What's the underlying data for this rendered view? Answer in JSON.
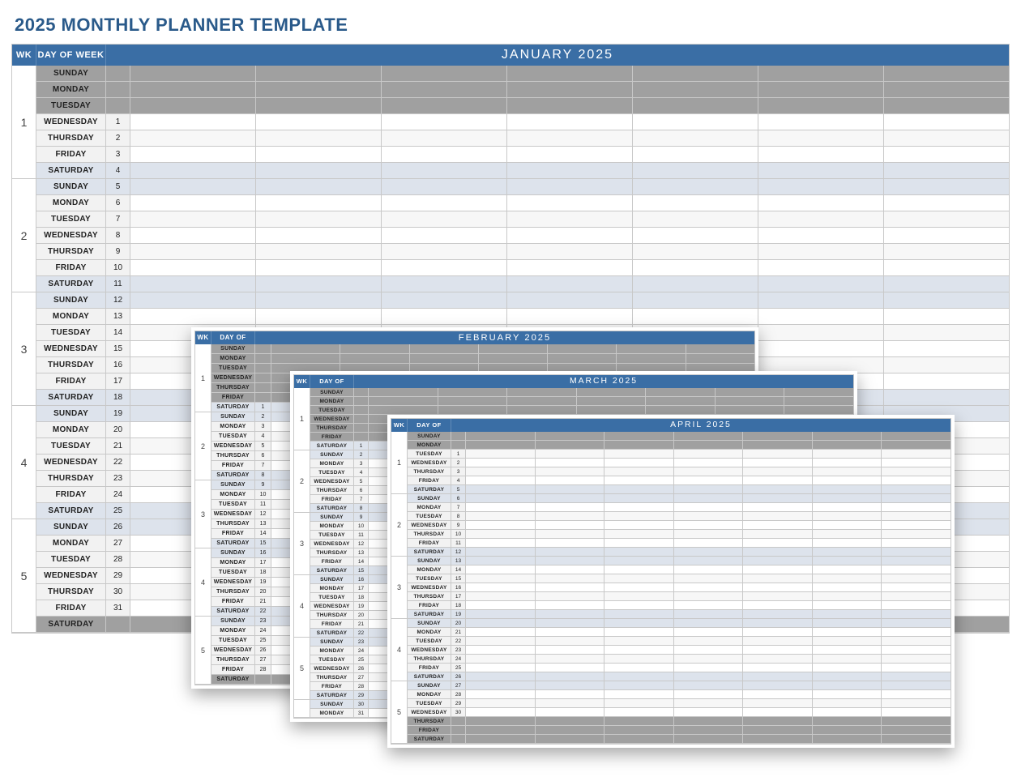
{
  "page_title": "2025 MONTHLY PLANNER TEMPLATE",
  "headers": {
    "wk": "WK",
    "dow": "DAY OF WEEK"
  },
  "day_names": [
    "SUNDAY",
    "MONDAY",
    "TUESDAY",
    "WEDNESDAY",
    "THURSDAY",
    "FRIDAY",
    "SATURDAY"
  ],
  "columns": 7,
  "planners": [
    {
      "id": "january",
      "size": "main",
      "month_label": "JANUARY 2025",
      "weeks": [
        {
          "num": 1,
          "days": [
            {
              "dow": "SUNDAY",
              "n": "",
              "type": "inactive"
            },
            {
              "dow": "MONDAY",
              "n": "",
              "type": "inactive"
            },
            {
              "dow": "TUESDAY",
              "n": "",
              "type": "inactive"
            },
            {
              "dow": "WEDNESDAY",
              "n": 1,
              "type": "normal"
            },
            {
              "dow": "THURSDAY",
              "n": 2,
              "type": "alt"
            },
            {
              "dow": "FRIDAY",
              "n": 3,
              "type": "normal"
            },
            {
              "dow": "SATURDAY",
              "n": 4,
              "type": "weekend"
            }
          ]
        },
        {
          "num": 2,
          "days": [
            {
              "dow": "SUNDAY",
              "n": 5,
              "type": "weekend"
            },
            {
              "dow": "MONDAY",
              "n": 6,
              "type": "normal"
            },
            {
              "dow": "TUESDAY",
              "n": 7,
              "type": "alt"
            },
            {
              "dow": "WEDNESDAY",
              "n": 8,
              "type": "normal"
            },
            {
              "dow": "THURSDAY",
              "n": 9,
              "type": "alt"
            },
            {
              "dow": "FRIDAY",
              "n": 10,
              "type": "normal"
            },
            {
              "dow": "SATURDAY",
              "n": 11,
              "type": "weekend"
            }
          ]
        },
        {
          "num": 3,
          "days": [
            {
              "dow": "SUNDAY",
              "n": 12,
              "type": "weekend"
            },
            {
              "dow": "MONDAY",
              "n": 13,
              "type": "normal"
            },
            {
              "dow": "TUESDAY",
              "n": 14,
              "type": "alt"
            },
            {
              "dow": "WEDNESDAY",
              "n": 15,
              "type": "normal"
            },
            {
              "dow": "THURSDAY",
              "n": 16,
              "type": "alt"
            },
            {
              "dow": "FRIDAY",
              "n": 17,
              "type": "normal"
            },
            {
              "dow": "SATURDAY",
              "n": 18,
              "type": "weekend"
            }
          ]
        },
        {
          "num": 4,
          "days": [
            {
              "dow": "SUNDAY",
              "n": 19,
              "type": "weekend"
            },
            {
              "dow": "MONDAY",
              "n": 20,
              "type": "normal"
            },
            {
              "dow": "TUESDAY",
              "n": 21,
              "type": "alt"
            },
            {
              "dow": "WEDNESDAY",
              "n": 22,
              "type": "normal"
            },
            {
              "dow": "THURSDAY",
              "n": 23,
              "type": "alt"
            },
            {
              "dow": "FRIDAY",
              "n": 24,
              "type": "normal"
            },
            {
              "dow": "SATURDAY",
              "n": 25,
              "type": "weekend"
            }
          ]
        },
        {
          "num": 5,
          "days": [
            {
              "dow": "SUNDAY",
              "n": 26,
              "type": "weekend"
            },
            {
              "dow": "MONDAY",
              "n": 27,
              "type": "normal"
            },
            {
              "dow": "TUESDAY",
              "n": 28,
              "type": "alt"
            },
            {
              "dow": "WEDNESDAY",
              "n": 29,
              "type": "normal"
            },
            {
              "dow": "THURSDAY",
              "n": 30,
              "type": "alt"
            },
            {
              "dow": "FRIDAY",
              "n": 31,
              "type": "normal"
            },
            {
              "dow": "SATURDAY",
              "n": "",
              "type": "inactive"
            }
          ]
        }
      ]
    },
    {
      "id": "february",
      "size": "small1",
      "month_label": "FEBRUARY 2025",
      "weeks": [
        {
          "num": 1,
          "days": [
            {
              "dow": "SUNDAY",
              "n": "",
              "type": "inactive"
            },
            {
              "dow": "MONDAY",
              "n": "",
              "type": "inactive"
            },
            {
              "dow": "TUESDAY",
              "n": "",
              "type": "inactive"
            },
            {
              "dow": "WEDNESDAY",
              "n": "",
              "type": "inactive"
            },
            {
              "dow": "THURSDAY",
              "n": "",
              "type": "inactive"
            },
            {
              "dow": "FRIDAY",
              "n": "",
              "type": "inactive"
            },
            {
              "dow": "SATURDAY",
              "n": 1,
              "type": "weekend"
            }
          ]
        },
        {
          "num": 2,
          "days": [
            {
              "dow": "SUNDAY",
              "n": 2,
              "type": "weekend"
            },
            {
              "dow": "MONDAY",
              "n": 3,
              "type": "normal"
            },
            {
              "dow": "TUESDAY",
              "n": 4,
              "type": "alt"
            },
            {
              "dow": "WEDNESDAY",
              "n": 5,
              "type": "normal"
            },
            {
              "dow": "THURSDAY",
              "n": 6,
              "type": "alt"
            },
            {
              "dow": "FRIDAY",
              "n": 7,
              "type": "normal"
            },
            {
              "dow": "SATURDAY",
              "n": 8,
              "type": "weekend"
            }
          ]
        },
        {
          "num": 3,
          "days": [
            {
              "dow": "SUNDAY",
              "n": 9,
              "type": "weekend"
            },
            {
              "dow": "MONDAY",
              "n": 10,
              "type": "normal"
            },
            {
              "dow": "TUESDAY",
              "n": 11,
              "type": "alt"
            },
            {
              "dow": "WEDNESDAY",
              "n": 12,
              "type": "normal"
            },
            {
              "dow": "THURSDAY",
              "n": 13,
              "type": "alt"
            },
            {
              "dow": "FRIDAY",
              "n": 14,
              "type": "normal"
            },
            {
              "dow": "SATURDAY",
              "n": 15,
              "type": "weekend"
            }
          ]
        },
        {
          "num": 4,
          "days": [
            {
              "dow": "SUNDAY",
              "n": 16,
              "type": "weekend"
            },
            {
              "dow": "MONDAY",
              "n": 17,
              "type": "normal"
            },
            {
              "dow": "TUESDAY",
              "n": 18,
              "type": "alt"
            },
            {
              "dow": "WEDNESDAY",
              "n": 19,
              "type": "normal"
            },
            {
              "dow": "THURSDAY",
              "n": 20,
              "type": "alt"
            },
            {
              "dow": "FRIDAY",
              "n": 21,
              "type": "normal"
            },
            {
              "dow": "SATURDAY",
              "n": 22,
              "type": "weekend"
            }
          ]
        },
        {
          "num": 5,
          "days": [
            {
              "dow": "SUNDAY",
              "n": 23,
              "type": "weekend"
            },
            {
              "dow": "MONDAY",
              "n": 24,
              "type": "normal"
            },
            {
              "dow": "TUESDAY",
              "n": 25,
              "type": "alt"
            },
            {
              "dow": "WEDNESDAY",
              "n": 26,
              "type": "normal"
            },
            {
              "dow": "THURSDAY",
              "n": 27,
              "type": "alt"
            },
            {
              "dow": "FRIDAY",
              "n": 28,
              "type": "normal"
            },
            {
              "dow": "SATURDAY",
              "n": "",
              "type": "inactive"
            }
          ]
        }
      ]
    },
    {
      "id": "march",
      "size": "small2",
      "month_label": "MARCH 2025",
      "weeks": [
        {
          "num": 1,
          "days": [
            {
              "dow": "SUNDAY",
              "n": "",
              "type": "inactive"
            },
            {
              "dow": "MONDAY",
              "n": "",
              "type": "inactive"
            },
            {
              "dow": "TUESDAY",
              "n": "",
              "type": "inactive"
            },
            {
              "dow": "WEDNESDAY",
              "n": "",
              "type": "inactive"
            },
            {
              "dow": "THURSDAY",
              "n": "",
              "type": "inactive"
            },
            {
              "dow": "FRIDAY",
              "n": "",
              "type": "inactive"
            },
            {
              "dow": "SATURDAY",
              "n": 1,
              "type": "weekend"
            }
          ]
        },
        {
          "num": 2,
          "days": [
            {
              "dow": "SUNDAY",
              "n": 2,
              "type": "weekend"
            },
            {
              "dow": "MONDAY",
              "n": 3,
              "type": "normal"
            },
            {
              "dow": "TUESDAY",
              "n": 4,
              "type": "alt"
            },
            {
              "dow": "WEDNESDAY",
              "n": 5,
              "type": "normal"
            },
            {
              "dow": "THURSDAY",
              "n": 6,
              "type": "alt"
            },
            {
              "dow": "FRIDAY",
              "n": 7,
              "type": "normal"
            },
            {
              "dow": "SATURDAY",
              "n": 8,
              "type": "weekend"
            }
          ]
        },
        {
          "num": 3,
          "days": [
            {
              "dow": "SUNDAY",
              "n": 9,
              "type": "weekend"
            },
            {
              "dow": "MONDAY",
              "n": 10,
              "type": "normal"
            },
            {
              "dow": "TUESDAY",
              "n": 11,
              "type": "alt"
            },
            {
              "dow": "WEDNESDAY",
              "n": 12,
              "type": "normal"
            },
            {
              "dow": "THURSDAY",
              "n": 13,
              "type": "alt"
            },
            {
              "dow": "FRIDAY",
              "n": 14,
              "type": "normal"
            },
            {
              "dow": "SATURDAY",
              "n": 15,
              "type": "weekend"
            }
          ]
        },
        {
          "num": 4,
          "days": [
            {
              "dow": "SUNDAY",
              "n": 16,
              "type": "weekend"
            },
            {
              "dow": "MONDAY",
              "n": 17,
              "type": "normal"
            },
            {
              "dow": "TUESDAY",
              "n": 18,
              "type": "alt"
            },
            {
              "dow": "WEDNESDAY",
              "n": 19,
              "type": "normal"
            },
            {
              "dow": "THURSDAY",
              "n": 20,
              "type": "alt"
            },
            {
              "dow": "FRIDAY",
              "n": 21,
              "type": "normal"
            },
            {
              "dow": "SATURDAY",
              "n": 22,
              "type": "weekend"
            }
          ]
        },
        {
          "num": 5,
          "days": [
            {
              "dow": "SUNDAY",
              "n": 23,
              "type": "weekend"
            },
            {
              "dow": "MONDAY",
              "n": 24,
              "type": "normal"
            },
            {
              "dow": "TUESDAY",
              "n": 25,
              "type": "alt"
            },
            {
              "dow": "WEDNESDAY",
              "n": 26,
              "type": "normal"
            },
            {
              "dow": "THURSDAY",
              "n": 27,
              "type": "alt"
            },
            {
              "dow": "FRIDAY",
              "n": 28,
              "type": "normal"
            },
            {
              "dow": "SATURDAY",
              "n": 29,
              "type": "weekend"
            }
          ]
        },
        {
          "num": "",
          "days": [
            {
              "dow": "SUNDAY",
              "n": 30,
              "type": "weekend"
            },
            {
              "dow": "MONDAY",
              "n": 31,
              "type": "normal"
            }
          ]
        }
      ]
    },
    {
      "id": "april",
      "size": "small3",
      "month_label": "APRIL 2025",
      "weeks": [
        {
          "num": 1,
          "days": [
            {
              "dow": "SUNDAY",
              "n": "",
              "type": "inactive"
            },
            {
              "dow": "MONDAY",
              "n": "",
              "type": "inactive"
            },
            {
              "dow": "TUESDAY",
              "n": 1,
              "type": "alt"
            },
            {
              "dow": "WEDNESDAY",
              "n": 2,
              "type": "normal"
            },
            {
              "dow": "THURSDAY",
              "n": 3,
              "type": "alt"
            },
            {
              "dow": "FRIDAY",
              "n": 4,
              "type": "normal"
            },
            {
              "dow": "SATURDAY",
              "n": 5,
              "type": "weekend"
            }
          ]
        },
        {
          "num": 2,
          "days": [
            {
              "dow": "SUNDAY",
              "n": 6,
              "type": "weekend"
            },
            {
              "dow": "MONDAY",
              "n": 7,
              "type": "normal"
            },
            {
              "dow": "TUESDAY",
              "n": 8,
              "type": "alt"
            },
            {
              "dow": "WEDNESDAY",
              "n": 9,
              "type": "normal"
            },
            {
              "dow": "THURSDAY",
              "n": 10,
              "type": "alt"
            },
            {
              "dow": "FRIDAY",
              "n": 11,
              "type": "normal"
            },
            {
              "dow": "SATURDAY",
              "n": 12,
              "type": "weekend"
            }
          ]
        },
        {
          "num": 3,
          "days": [
            {
              "dow": "SUNDAY",
              "n": 13,
              "type": "weekend"
            },
            {
              "dow": "MONDAY",
              "n": 14,
              "type": "normal"
            },
            {
              "dow": "TUESDAY",
              "n": 15,
              "type": "alt"
            },
            {
              "dow": "WEDNESDAY",
              "n": 16,
              "type": "normal"
            },
            {
              "dow": "THURSDAY",
              "n": 17,
              "type": "alt"
            },
            {
              "dow": "FRIDAY",
              "n": 18,
              "type": "normal"
            },
            {
              "dow": "SATURDAY",
              "n": 19,
              "type": "weekend"
            }
          ]
        },
        {
          "num": 4,
          "days": [
            {
              "dow": "SUNDAY",
              "n": 20,
              "type": "weekend"
            },
            {
              "dow": "MONDAY",
              "n": 21,
              "type": "normal"
            },
            {
              "dow": "TUESDAY",
              "n": 22,
              "type": "alt"
            },
            {
              "dow": "WEDNESDAY",
              "n": 23,
              "type": "normal"
            },
            {
              "dow": "THURSDAY",
              "n": 24,
              "type": "alt"
            },
            {
              "dow": "FRIDAY",
              "n": 25,
              "type": "normal"
            },
            {
              "dow": "SATURDAY",
              "n": 26,
              "type": "weekend"
            }
          ]
        },
        {
          "num": 5,
          "days": [
            {
              "dow": "SUNDAY",
              "n": 27,
              "type": "weekend"
            },
            {
              "dow": "MONDAY",
              "n": 28,
              "type": "normal"
            },
            {
              "dow": "TUESDAY",
              "n": 29,
              "type": "alt"
            },
            {
              "dow": "WEDNESDAY",
              "n": 30,
              "type": "normal"
            },
            {
              "dow": "THURSDAY",
              "n": "",
              "type": "inactive"
            },
            {
              "dow": "FRIDAY",
              "n": "",
              "type": "inactive"
            },
            {
              "dow": "SATURDAY",
              "n": "",
              "type": "inactive"
            }
          ]
        }
      ]
    }
  ]
}
